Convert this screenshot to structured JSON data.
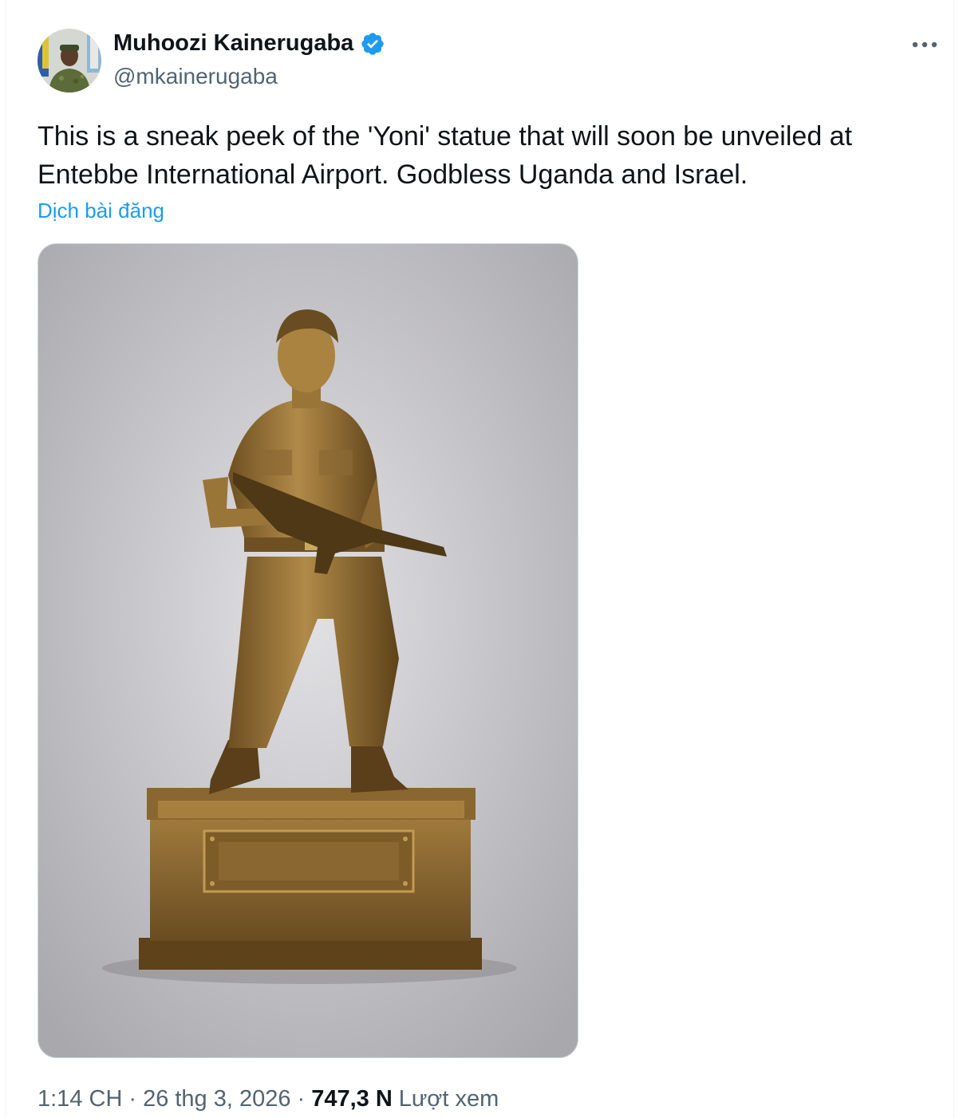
{
  "author": {
    "display_name": "Muhoozi Kainerugaba",
    "handle": "@mkainerugaba",
    "verified": true
  },
  "icons": {
    "verified": "verified-badge-icon",
    "more": "more-options-icon"
  },
  "tweet": {
    "text": "This is a sneak peek of the 'Yoni' statue that will soon be unveiled at Entebbe International Airport. Godbless Uganda and Israel.",
    "translate_label": "Dịch bài đăng"
  },
  "meta": {
    "time": "1:14 CH",
    "separator": "·",
    "date": "26 thg 3, 2026",
    "views_count": "747,3 N",
    "views_label": "Lượt xem"
  },
  "colors": {
    "accent": "#1d9bf0",
    "text_primary": "#0f1419",
    "text_secondary": "#536471",
    "bronze": "#9c7838"
  }
}
